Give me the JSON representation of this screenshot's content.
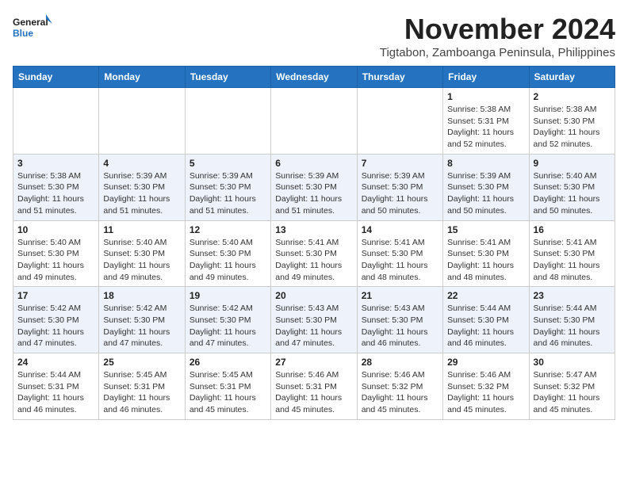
{
  "header": {
    "logo_line1": "General",
    "logo_line2": "Blue",
    "month": "November 2024",
    "location": "Tigtabon, Zamboanga Peninsula, Philippines"
  },
  "days_of_week": [
    "Sunday",
    "Monday",
    "Tuesday",
    "Wednesday",
    "Thursday",
    "Friday",
    "Saturday"
  ],
  "weeks": [
    [
      {
        "day": "",
        "info": ""
      },
      {
        "day": "",
        "info": ""
      },
      {
        "day": "",
        "info": ""
      },
      {
        "day": "",
        "info": ""
      },
      {
        "day": "",
        "info": ""
      },
      {
        "day": "1",
        "info": "Sunrise: 5:38 AM\nSunset: 5:31 PM\nDaylight: 11 hours\nand 52 minutes."
      },
      {
        "day": "2",
        "info": "Sunrise: 5:38 AM\nSunset: 5:30 PM\nDaylight: 11 hours\nand 52 minutes."
      }
    ],
    [
      {
        "day": "3",
        "info": "Sunrise: 5:38 AM\nSunset: 5:30 PM\nDaylight: 11 hours\nand 51 minutes."
      },
      {
        "day": "4",
        "info": "Sunrise: 5:39 AM\nSunset: 5:30 PM\nDaylight: 11 hours\nand 51 minutes."
      },
      {
        "day": "5",
        "info": "Sunrise: 5:39 AM\nSunset: 5:30 PM\nDaylight: 11 hours\nand 51 minutes."
      },
      {
        "day": "6",
        "info": "Sunrise: 5:39 AM\nSunset: 5:30 PM\nDaylight: 11 hours\nand 51 minutes."
      },
      {
        "day": "7",
        "info": "Sunrise: 5:39 AM\nSunset: 5:30 PM\nDaylight: 11 hours\nand 50 minutes."
      },
      {
        "day": "8",
        "info": "Sunrise: 5:39 AM\nSunset: 5:30 PM\nDaylight: 11 hours\nand 50 minutes."
      },
      {
        "day": "9",
        "info": "Sunrise: 5:40 AM\nSunset: 5:30 PM\nDaylight: 11 hours\nand 50 minutes."
      }
    ],
    [
      {
        "day": "10",
        "info": "Sunrise: 5:40 AM\nSunset: 5:30 PM\nDaylight: 11 hours\nand 49 minutes."
      },
      {
        "day": "11",
        "info": "Sunrise: 5:40 AM\nSunset: 5:30 PM\nDaylight: 11 hours\nand 49 minutes."
      },
      {
        "day": "12",
        "info": "Sunrise: 5:40 AM\nSunset: 5:30 PM\nDaylight: 11 hours\nand 49 minutes."
      },
      {
        "day": "13",
        "info": "Sunrise: 5:41 AM\nSunset: 5:30 PM\nDaylight: 11 hours\nand 49 minutes."
      },
      {
        "day": "14",
        "info": "Sunrise: 5:41 AM\nSunset: 5:30 PM\nDaylight: 11 hours\nand 48 minutes."
      },
      {
        "day": "15",
        "info": "Sunrise: 5:41 AM\nSunset: 5:30 PM\nDaylight: 11 hours\nand 48 minutes."
      },
      {
        "day": "16",
        "info": "Sunrise: 5:41 AM\nSunset: 5:30 PM\nDaylight: 11 hours\nand 48 minutes."
      }
    ],
    [
      {
        "day": "17",
        "info": "Sunrise: 5:42 AM\nSunset: 5:30 PM\nDaylight: 11 hours\nand 47 minutes."
      },
      {
        "day": "18",
        "info": "Sunrise: 5:42 AM\nSunset: 5:30 PM\nDaylight: 11 hours\nand 47 minutes."
      },
      {
        "day": "19",
        "info": "Sunrise: 5:42 AM\nSunset: 5:30 PM\nDaylight: 11 hours\nand 47 minutes."
      },
      {
        "day": "20",
        "info": "Sunrise: 5:43 AM\nSunset: 5:30 PM\nDaylight: 11 hours\nand 47 minutes."
      },
      {
        "day": "21",
        "info": "Sunrise: 5:43 AM\nSunset: 5:30 PM\nDaylight: 11 hours\nand 46 minutes."
      },
      {
        "day": "22",
        "info": "Sunrise: 5:44 AM\nSunset: 5:30 PM\nDaylight: 11 hours\nand 46 minutes."
      },
      {
        "day": "23",
        "info": "Sunrise: 5:44 AM\nSunset: 5:30 PM\nDaylight: 11 hours\nand 46 minutes."
      }
    ],
    [
      {
        "day": "24",
        "info": "Sunrise: 5:44 AM\nSunset: 5:31 PM\nDaylight: 11 hours\nand 46 minutes."
      },
      {
        "day": "25",
        "info": "Sunrise: 5:45 AM\nSunset: 5:31 PM\nDaylight: 11 hours\nand 46 minutes."
      },
      {
        "day": "26",
        "info": "Sunrise: 5:45 AM\nSunset: 5:31 PM\nDaylight: 11 hours\nand 45 minutes."
      },
      {
        "day": "27",
        "info": "Sunrise: 5:46 AM\nSunset: 5:31 PM\nDaylight: 11 hours\nand 45 minutes."
      },
      {
        "day": "28",
        "info": "Sunrise: 5:46 AM\nSunset: 5:32 PM\nDaylight: 11 hours\nand 45 minutes."
      },
      {
        "day": "29",
        "info": "Sunrise: 5:46 AM\nSunset: 5:32 PM\nDaylight: 11 hours\nand 45 minutes."
      },
      {
        "day": "30",
        "info": "Sunrise: 5:47 AM\nSunset: 5:32 PM\nDaylight: 11 hours\nand 45 minutes."
      }
    ]
  ]
}
